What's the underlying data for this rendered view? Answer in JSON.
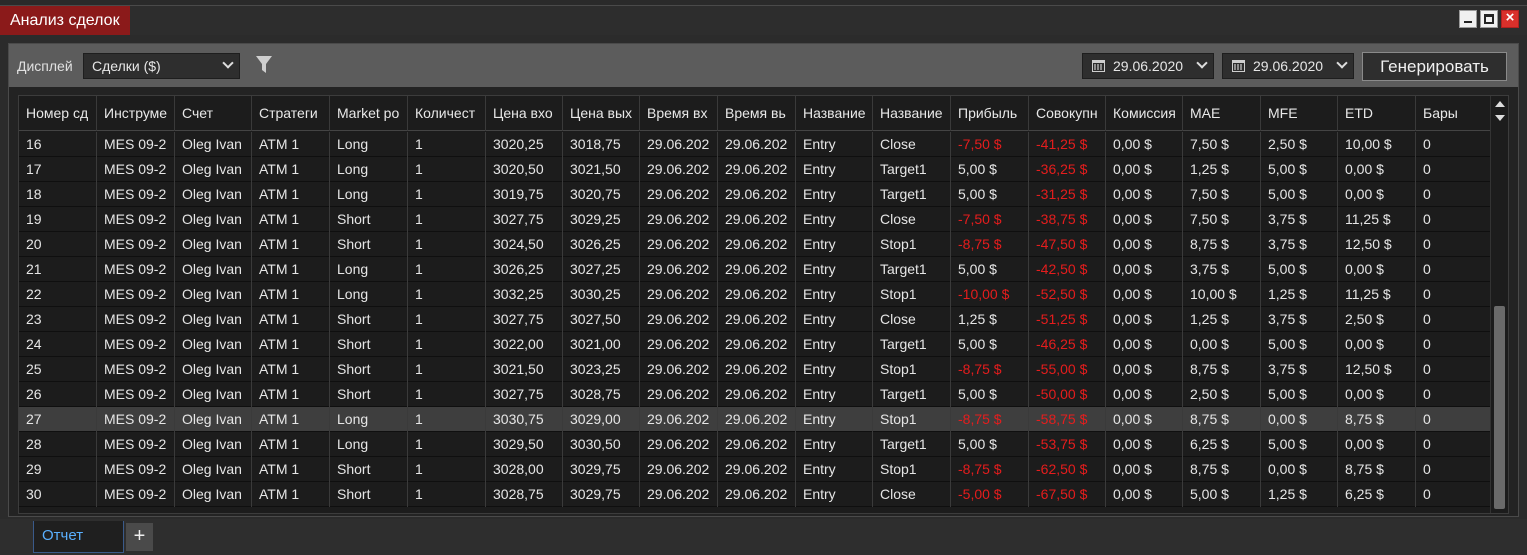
{
  "window": {
    "title": "Анализ сделок"
  },
  "toolbar": {
    "display_label": "Дисплей",
    "display_value": "Сделки ($)",
    "date_from": "29.06.2020",
    "date_to": "29.06.2020",
    "generate_label": "Генерировать"
  },
  "table": {
    "columns": [
      "Номер сд",
      "Инструме",
      "Счет",
      "Стратеги",
      "Market po",
      "Количест",
      "Цена вхо",
      "Цена вых",
      "Время вх",
      "Время вь",
      "Название",
      "Название",
      "Прибыль",
      "Совокупн",
      "Комиссия",
      "MAE",
      "MFE",
      "ETD",
      "Бары"
    ],
    "rows": [
      [
        "16",
        "MES 09-2",
        "Oleg Ivan",
        "ATM 1",
        "Long",
        "1",
        "3020,25",
        "3018,75",
        "29.06.202",
        "29.06.202",
        "Entry",
        "Close",
        "-7,50 $",
        "-41,25 $",
        "0,00 $",
        "7,50 $",
        "2,50 $",
        "10,00 $",
        "0"
      ],
      [
        "17",
        "MES 09-2",
        "Oleg Ivan",
        "ATM 1",
        "Long",
        "1",
        "3020,50",
        "3021,50",
        "29.06.202",
        "29.06.202",
        "Entry",
        "Target1",
        "5,00 $",
        "-36,25 $",
        "0,00 $",
        "1,25 $",
        "5,00 $",
        "0,00 $",
        "0"
      ],
      [
        "18",
        "MES 09-2",
        "Oleg Ivan",
        "ATM 1",
        "Long",
        "1",
        "3019,75",
        "3020,75",
        "29.06.202",
        "29.06.202",
        "Entry",
        "Target1",
        "5,00 $",
        "-31,25 $",
        "0,00 $",
        "7,50 $",
        "5,00 $",
        "0,00 $",
        "0"
      ],
      [
        "19",
        "MES 09-2",
        "Oleg Ivan",
        "ATM 1",
        "Short",
        "1",
        "3027,75",
        "3029,25",
        "29.06.202",
        "29.06.202",
        "Entry",
        "Close",
        "-7,50 $",
        "-38,75 $",
        "0,00 $",
        "7,50 $",
        "3,75 $",
        "11,25 $",
        "0"
      ],
      [
        "20",
        "MES 09-2",
        "Oleg Ivan",
        "ATM 1",
        "Short",
        "1",
        "3024,50",
        "3026,25",
        "29.06.202",
        "29.06.202",
        "Entry",
        "Stop1",
        "-8,75 $",
        "-47,50 $",
        "0,00 $",
        "8,75 $",
        "3,75 $",
        "12,50 $",
        "0"
      ],
      [
        "21",
        "MES 09-2",
        "Oleg Ivan",
        "ATM 1",
        "Long",
        "1",
        "3026,25",
        "3027,25",
        "29.06.202",
        "29.06.202",
        "Entry",
        "Target1",
        "5,00 $",
        "-42,50 $",
        "0,00 $",
        "3,75 $",
        "5,00 $",
        "0,00 $",
        "0"
      ],
      [
        "22",
        "MES 09-2",
        "Oleg Ivan",
        "ATM 1",
        "Long",
        "1",
        "3032,25",
        "3030,25",
        "29.06.202",
        "29.06.202",
        "Entry",
        "Stop1",
        "-10,00 $",
        "-52,50 $",
        "0,00 $",
        "10,00 $",
        "1,25 $",
        "11,25 $",
        "0"
      ],
      [
        "23",
        "MES 09-2",
        "Oleg Ivan",
        "ATM 1",
        "Short",
        "1",
        "3027,75",
        "3027,50",
        "29.06.202",
        "29.06.202",
        "Entry",
        "Close",
        "1,25 $",
        "-51,25 $",
        "0,00 $",
        "1,25 $",
        "3,75 $",
        "2,50 $",
        "0"
      ],
      [
        "24",
        "MES 09-2",
        "Oleg Ivan",
        "ATM 1",
        "Short",
        "1",
        "3022,00",
        "3021,00",
        "29.06.202",
        "29.06.202",
        "Entry",
        "Target1",
        "5,00 $",
        "-46,25 $",
        "0,00 $",
        "0,00 $",
        "5,00 $",
        "0,00 $",
        "0"
      ],
      [
        "25",
        "MES 09-2",
        "Oleg Ivan",
        "ATM 1",
        "Short",
        "1",
        "3021,50",
        "3023,25",
        "29.06.202",
        "29.06.202",
        "Entry",
        "Stop1",
        "-8,75 $",
        "-55,00 $",
        "0,00 $",
        "8,75 $",
        "3,75 $",
        "12,50 $",
        "0"
      ],
      [
        "26",
        "MES 09-2",
        "Oleg Ivan",
        "ATM 1",
        "Short",
        "1",
        "3027,75",
        "3028,75",
        "29.06.202",
        "29.06.202",
        "Entry",
        "Target1",
        "5,00 $",
        "-50,00 $",
        "0,00 $",
        "2,50 $",
        "5,00 $",
        "0,00 $",
        "0"
      ],
      [
        "27",
        "MES 09-2",
        "Oleg Ivan",
        "ATM 1",
        "Long",
        "1",
        "3030,75",
        "3029,00",
        "29.06.202",
        "29.06.202",
        "Entry",
        "Stop1",
        "-8,75 $",
        "-58,75 $",
        "0,00 $",
        "8,75 $",
        "0,00 $",
        "8,75 $",
        "0"
      ],
      [
        "28",
        "MES 09-2",
        "Oleg Ivan",
        "ATM 1",
        "Long",
        "1",
        "3029,50",
        "3030,50",
        "29.06.202",
        "29.06.202",
        "Entry",
        "Target1",
        "5,00 $",
        "-53,75 $",
        "0,00 $",
        "6,25 $",
        "5,00 $",
        "0,00 $",
        "0"
      ],
      [
        "29",
        "MES 09-2",
        "Oleg Ivan",
        "ATM 1",
        "Short",
        "1",
        "3028,00",
        "3029,75",
        "29.06.202",
        "29.06.202",
        "Entry",
        "Stop1",
        "-8,75 $",
        "-62,50 $",
        "0,00 $",
        "8,75 $",
        "0,00 $",
        "8,75 $",
        "0"
      ],
      [
        "30",
        "MES 09-2",
        "Oleg Ivan",
        "ATM 1",
        "Short",
        "1",
        "3028,75",
        "3029,75",
        "29.06.202",
        "29.06.202",
        "Entry",
        "Close",
        "-5,00 $",
        "-67,50 $",
        "0,00 $",
        "5,00 $",
        "1,25 $",
        "6,25 $",
        "0"
      ]
    ],
    "selected_row": 11
  },
  "tabs": {
    "active_label": "Отчет",
    "add_label": "+"
  },
  "colors": {
    "title_bg": "#8b1a1a",
    "negative": "#e51d1d",
    "tab_accent": "#5ab0ff"
  }
}
